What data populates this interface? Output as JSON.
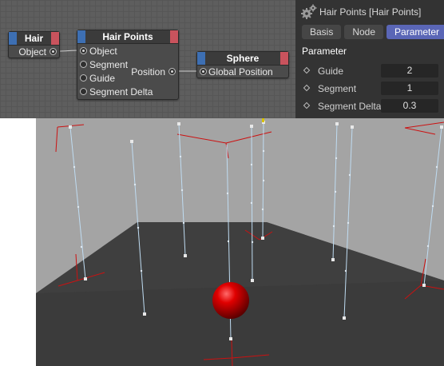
{
  "node_editor": {
    "nodes": {
      "hair": {
        "title": "Hair",
        "output": "Object"
      },
      "hair_points": {
        "title": "Hair Points",
        "inputs": [
          "Object",
          "Segment",
          "Guide",
          "Segment Delta"
        ],
        "output": "Position"
      },
      "sphere": {
        "title": "Sphere",
        "input": "Global Position"
      }
    },
    "colors": {
      "input_cap": "#3d6fb3",
      "output_cap": "#c9535d"
    }
  },
  "attributes": {
    "title": "Hair Points  [Hair Points]",
    "tabs": [
      "Basis",
      "Node",
      "Parameter"
    ],
    "active_tab": "Parameter",
    "section": "Parameter",
    "params": [
      {
        "label": "Guide",
        "value": "2"
      },
      {
        "label": "Segment",
        "value": "1"
      },
      {
        "label": "Segment Delta",
        "value": "0.3"
      }
    ],
    "accent": "#5a66b6"
  },
  "viewport": {
    "sphere_color": "#c40000",
    "guide_color": "#bfdcf2",
    "axis_color": "#cc0000",
    "floor_color": "#3a3a3a",
    "background_color": "#a4a4a4"
  }
}
